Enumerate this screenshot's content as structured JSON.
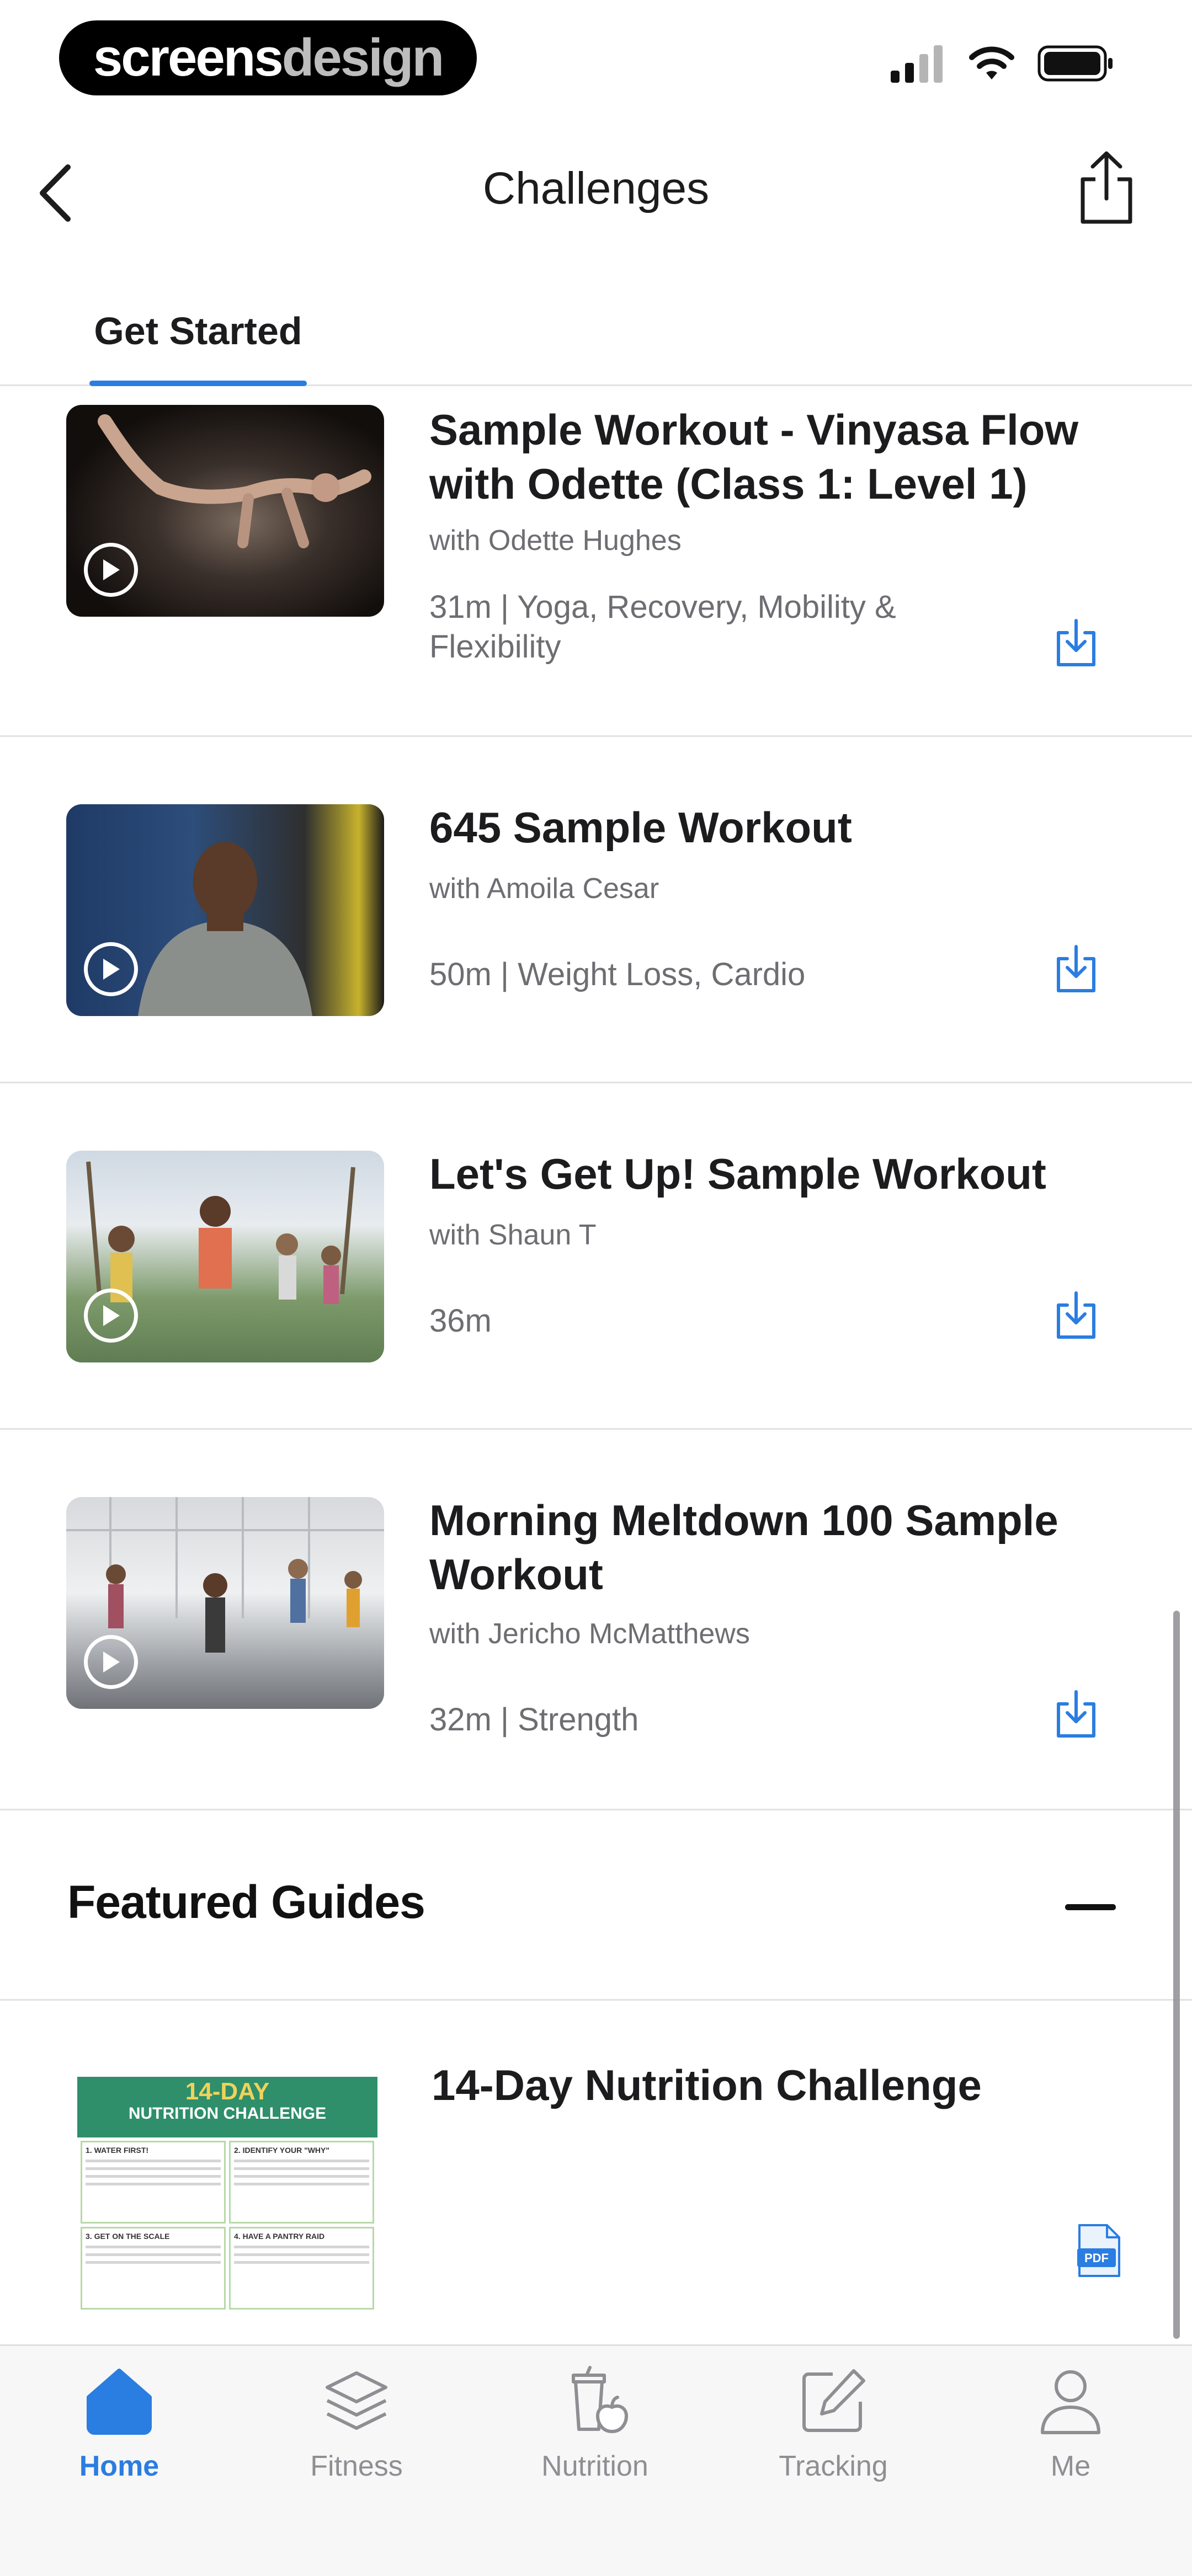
{
  "status_bar": {
    "brand_part1": "screens",
    "brand_part2": "design"
  },
  "header": {
    "title": "Challenges"
  },
  "tabs": [
    {
      "label": "Get Started"
    }
  ],
  "workouts": [
    {
      "title": "Sample Workout - Vinyasa Flow with Odette (Class 1: Level 1)",
      "trainer": "with Odette Hughes",
      "meta": "31m | Yoga, Recovery, Mobility & Flexibility"
    },
    {
      "title": "645 Sample Workout",
      "trainer": "with Amoila Cesar",
      "meta": "50m | Weight Loss, Cardio"
    },
    {
      "title": "Let's Get Up! Sample Workout",
      "trainer": "with Shaun T",
      "meta": "36m"
    },
    {
      "title": "Morning Meltdown 100 Sample Workout",
      "trainer": "with Jericho McMatthews",
      "meta": "32m | Strength"
    }
  ],
  "featured_guides": {
    "title": "Featured Guides",
    "items": [
      {
        "title": "14-Day Nutrition Challenge",
        "thumb_heading_1": "14-DAY",
        "thumb_heading_2": "NUTRITION CHALLENGE",
        "thumb_sections": [
          "1. WATER FIRST!",
          "2. IDENTIFY YOUR \"WHY\"",
          "3. GET ON THE SCALE",
          "4. HAVE A PANTRY RAID"
        ],
        "file_badge": "PDF"
      }
    ]
  },
  "tab_bar": [
    {
      "label": "Home",
      "icon": "home-icon",
      "active": true
    },
    {
      "label": "Fitness",
      "icon": "layers-icon",
      "active": false
    },
    {
      "label": "Nutrition",
      "icon": "nutrition-icon",
      "active": false
    },
    {
      "label": "Tracking",
      "icon": "edit-icon",
      "active": false
    },
    {
      "label": "Me",
      "icon": "person-icon",
      "active": false
    }
  ],
  "colors": {
    "accent": "#2a7de1",
    "text": "#1c1c1e",
    "secondary_text": "#6d6d72",
    "divider": "#e2e2e2"
  }
}
